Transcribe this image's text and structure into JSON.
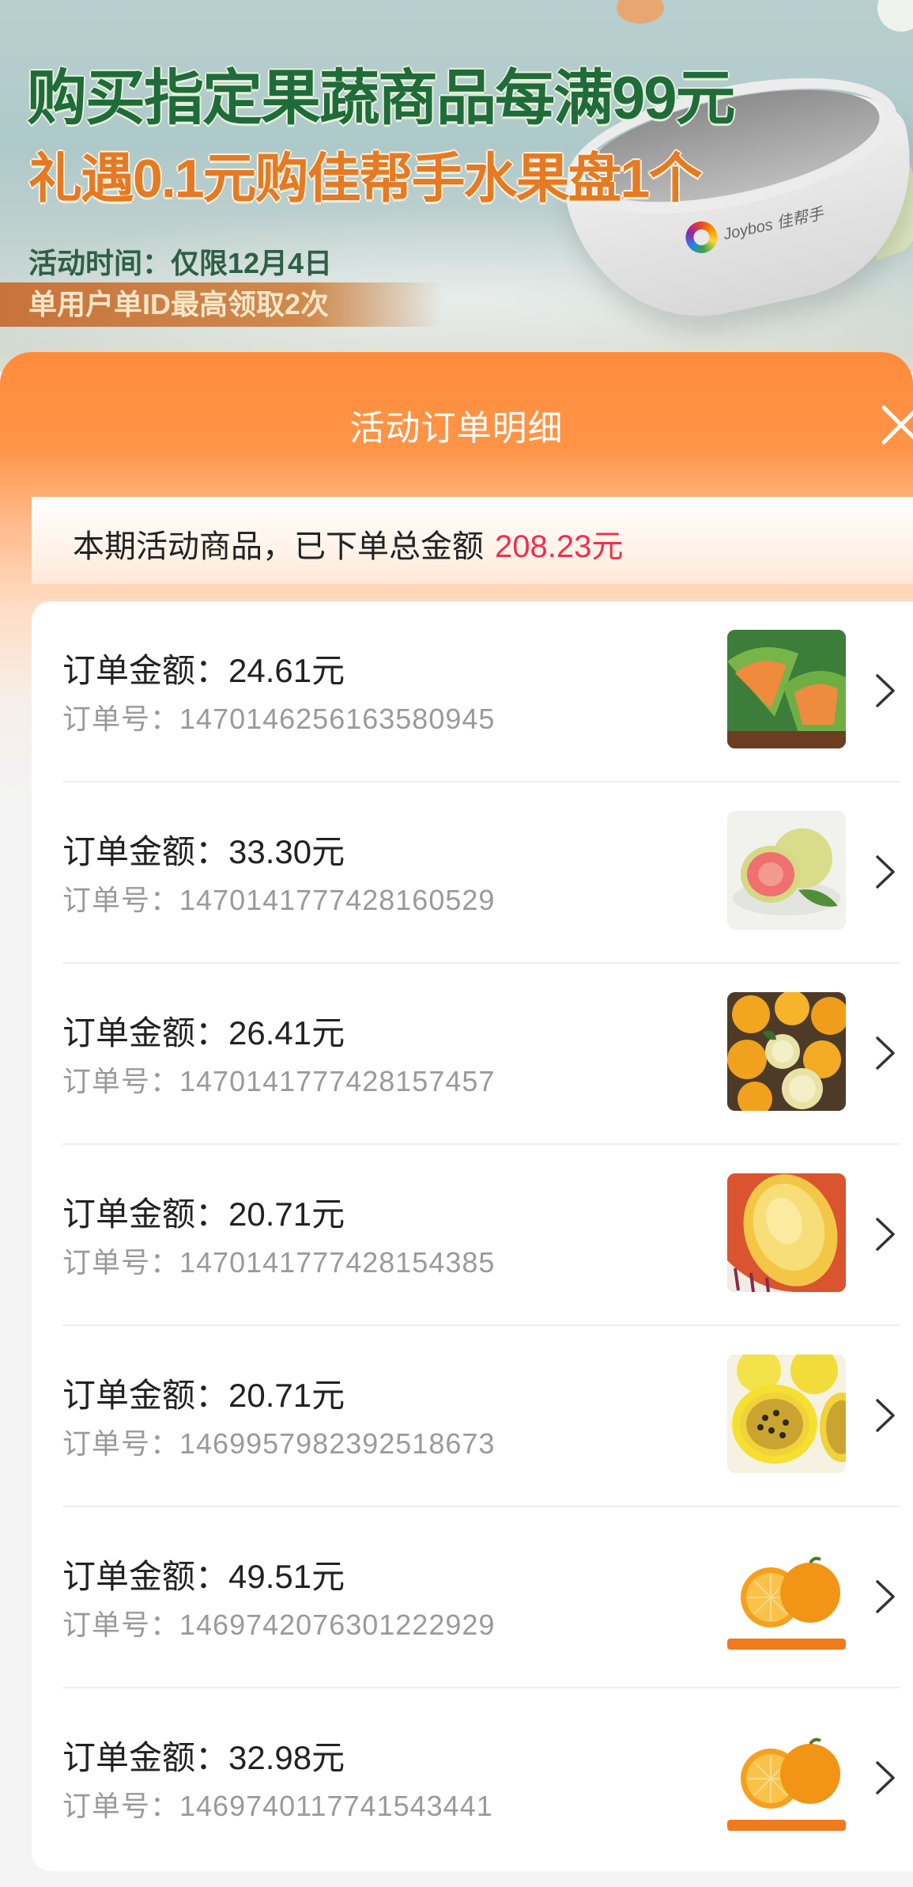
{
  "banner": {
    "headline": "购买指定果蔬商品每满99元",
    "subheadline": "礼遇0.1元购佳帮手水果盘1个",
    "activity_time": "活动时间：仅限12月4日",
    "limit_note": "单用户单ID最高领取2次",
    "product_brand": "Joybos 佳帮手"
  },
  "sheet": {
    "title": "活动订单明细",
    "close_icon": "close-icon",
    "summary_label": "本期活动商品，已下单总金额",
    "summary_amount": "208.23元"
  },
  "orders": [
    {
      "amount_label": "订单金额：24.61元",
      "order_no_label": "订单号：1470146256163580945",
      "thumb": "green-melon"
    },
    {
      "amount_label": "订单金额：33.30元",
      "order_no_label": "订单号：1470141777428160529",
      "thumb": "red-guava"
    },
    {
      "amount_label": "订单金额：26.41元",
      "order_no_label": "订单号：1470141777428157457",
      "thumb": "oranges"
    },
    {
      "amount_label": "订单金额：20.71元",
      "order_no_label": "订单号：1470141777428154385",
      "thumb": "pepino-melon"
    },
    {
      "amount_label": "订单金额：20.71元",
      "order_no_label": "订单号：1469957982392518673",
      "thumb": "passion-fruit"
    },
    {
      "amount_label": "订单金额：49.51元",
      "order_no_label": "订单号：1469742076301222929",
      "thumb": "navel-orange"
    },
    {
      "amount_label": "订单金额：32.98元",
      "order_no_label": "订单号：1469740117741543441",
      "thumb": "navel-orange"
    }
  ],
  "colors": {
    "accent_orange": "#ff8c3c",
    "amount_red": "#f0304a",
    "headline_green": "#1f6b3a",
    "subheadline_orange": "#e57a24"
  }
}
